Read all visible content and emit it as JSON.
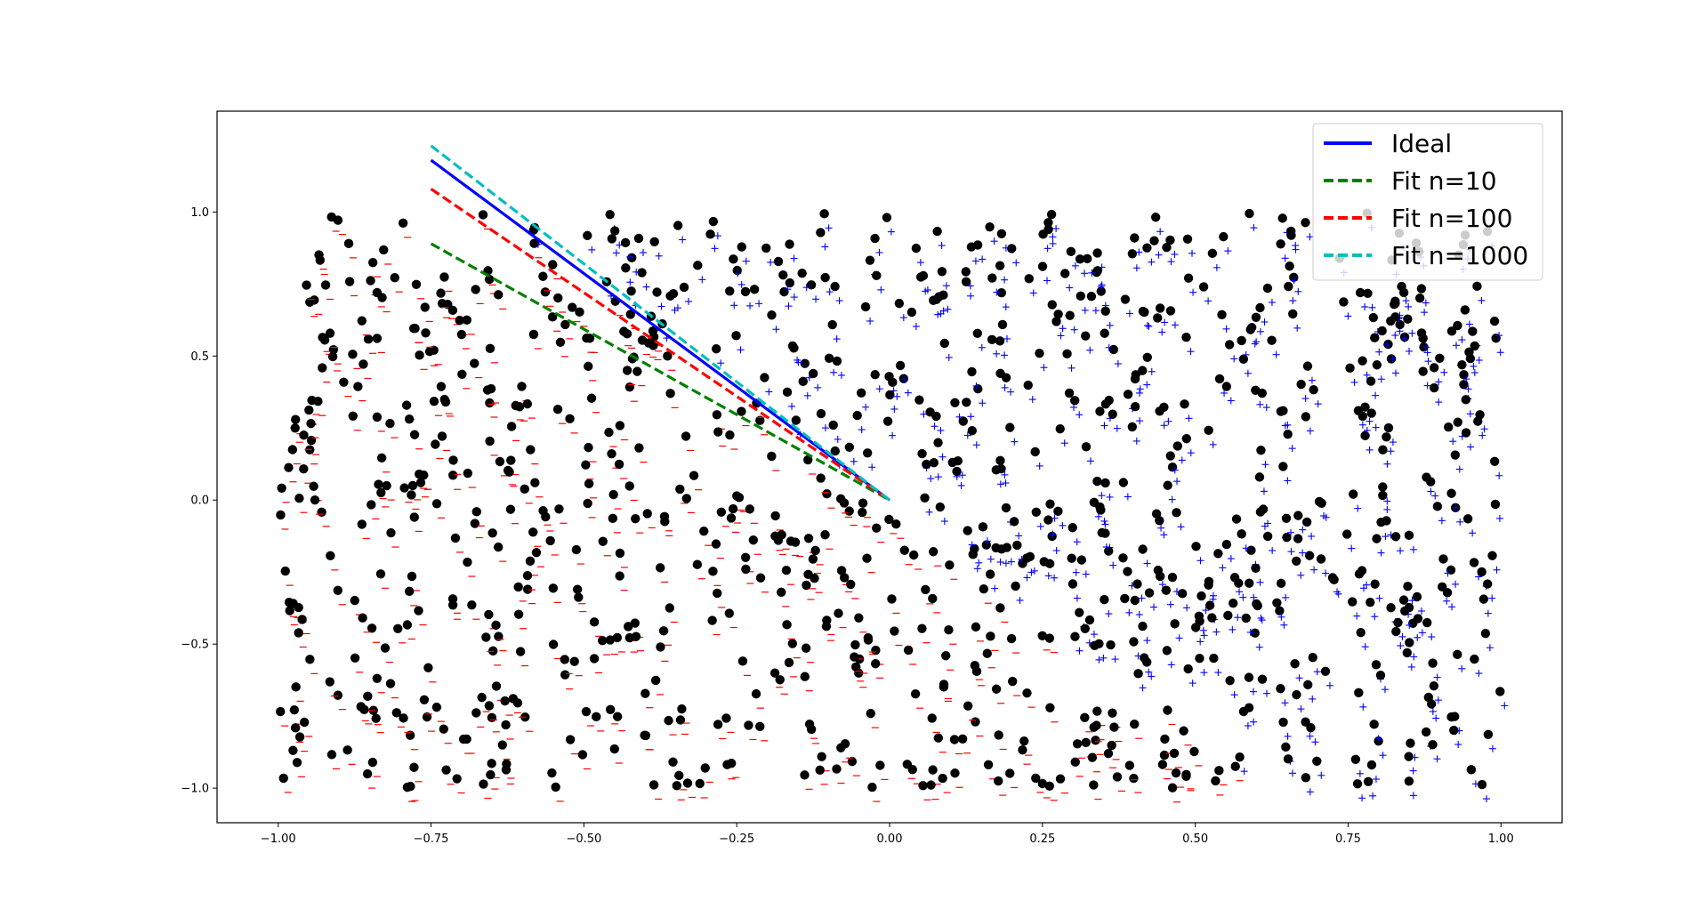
{
  "chart_data": {
    "type": "scatter",
    "title": "",
    "xlabel": "",
    "ylabel": "",
    "xlim": [
      -1.1,
      1.1
    ],
    "ylim": [
      -1.12,
      1.35
    ],
    "grid": false,
    "legend_position": "top-right",
    "x_ticks": [
      -1.0,
      -0.75,
      -0.5,
      -0.25,
      0.0,
      0.25,
      0.5,
      0.75,
      1.0
    ],
    "x_tick_labels": [
      "−1.00",
      "−0.75",
      "−0.50",
      "−0.25",
      "0.00",
      "0.25",
      "0.50",
      "0.75",
      "1.00"
    ],
    "y_ticks": [
      -1.0,
      -0.5,
      0.0,
      0.5,
      1.0
    ],
    "y_tick_labels": [
      "−1.0",
      "−0.5",
      "0.0",
      "0.5",
      "1.0"
    ],
    "point_distribution": {
      "count": 1000,
      "x_range": [
        -1.0,
        1.0
      ],
      "y_range": [
        -1.0,
        1.0
      ],
      "colors": {
        "dot": "#000000",
        "label_negative": "#ff0000",
        "label_positive": "#0000ff"
      },
      "marker_negative": "_",
      "marker_positive": "+"
    },
    "series": [
      {
        "name": "Ideal",
        "style": "solid",
        "color": "#0000ff",
        "x": [
          -0.75,
          0.0
        ],
        "y": [
          1.18,
          0.0
        ]
      },
      {
        "name": "Fit n=10",
        "style": "dashed",
        "color": "#008000",
        "x": [
          -0.75,
          0.0
        ],
        "y": [
          0.89,
          0.0
        ]
      },
      {
        "name": "Fit n=100",
        "style": "dashed",
        "color": "#ff0000",
        "x": [
          -0.75,
          0.0
        ],
        "y": [
          1.08,
          0.0
        ]
      },
      {
        "name": "Fit n=1000",
        "style": "dashed",
        "color": "#00bfbf",
        "x": [
          -0.75,
          0.0
        ],
        "y": [
          1.23,
          0.0
        ]
      }
    ]
  }
}
